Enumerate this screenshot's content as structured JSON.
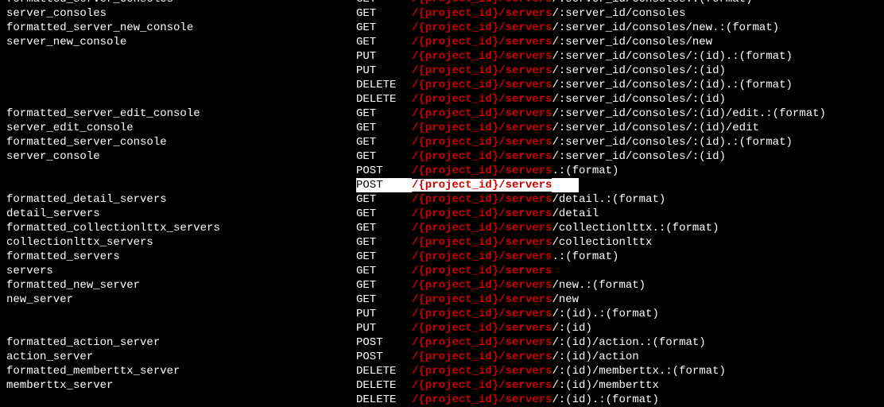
{
  "path_prefix": "/{project_id}/servers",
  "routes": [
    {
      "name": "formatted_server_consoles",
      "method": "GET",
      "tail": "/:server_id/consoles.:(format)",
      "highlight": false,
      "truncated": true
    },
    {
      "name": "server_consoles",
      "method": "GET",
      "tail": "/:server_id/consoles",
      "highlight": false
    },
    {
      "name": "formatted_server_new_console",
      "method": "GET",
      "tail": "/:server_id/consoles/new.:(format)",
      "highlight": false
    },
    {
      "name": "server_new_console",
      "method": "GET",
      "tail": "/:server_id/consoles/new",
      "highlight": false
    },
    {
      "name": "",
      "method": "PUT",
      "tail": "/:server_id/consoles/:(id).:(format)",
      "highlight": false
    },
    {
      "name": "",
      "method": "PUT",
      "tail": "/:server_id/consoles/:(id)",
      "highlight": false
    },
    {
      "name": "",
      "method": "DELETE",
      "tail": "/:server_id/consoles/:(id).:(format)",
      "highlight": false
    },
    {
      "name": "",
      "method": "DELETE",
      "tail": "/:server_id/consoles/:(id)",
      "highlight": false
    },
    {
      "name": "formatted_server_edit_console",
      "method": "GET",
      "tail": "/:server_id/consoles/:(id)/edit.:(format)",
      "highlight": false
    },
    {
      "name": "server_edit_console",
      "method": "GET",
      "tail": "/:server_id/consoles/:(id)/edit",
      "highlight": false
    },
    {
      "name": "formatted_server_console",
      "method": "GET",
      "tail": "/:server_id/consoles/:(id).:(format)",
      "highlight": false
    },
    {
      "name": "server_console",
      "method": "GET",
      "tail": "/:server_id/consoles/:(id)",
      "highlight": false
    },
    {
      "name": "",
      "method": "POST",
      "tail": ".:(format)",
      "highlight": false
    },
    {
      "name": "",
      "method": "POST",
      "tail": "",
      "highlight": true,
      "pad": "    "
    },
    {
      "name": "formatted_detail_servers",
      "method": "GET",
      "tail": "/detail.:(format)",
      "highlight": false
    },
    {
      "name": "detail_servers",
      "method": "GET",
      "tail": "/detail",
      "highlight": false
    },
    {
      "name": "formatted_collectionlttx_servers",
      "method": "GET",
      "tail": "/collectionlttx.:(format)",
      "highlight": false
    },
    {
      "name": "collectionlttx_servers",
      "method": "GET",
      "tail": "/collectionlttx",
      "highlight": false
    },
    {
      "name": "formatted_servers",
      "method": "GET",
      "tail": ".:(format)",
      "highlight": false
    },
    {
      "name": "servers",
      "method": "GET",
      "tail": "",
      "highlight": false
    },
    {
      "name": "formatted_new_server",
      "method": "GET",
      "tail": "/new.:(format)",
      "highlight": false
    },
    {
      "name": "new_server",
      "method": "GET",
      "tail": "/new",
      "highlight": false
    },
    {
      "name": "",
      "method": "PUT",
      "tail": "/:(id).:(format)",
      "highlight": false
    },
    {
      "name": "",
      "method": "PUT",
      "tail": "/:(id)",
      "highlight": false
    },
    {
      "name": "formatted_action_server",
      "method": "POST",
      "tail": "/:(id)/action.:(format)",
      "highlight": false
    },
    {
      "name": "action_server",
      "method": "POST",
      "tail": "/:(id)/action",
      "highlight": false
    },
    {
      "name": "formatted_memberttx_server",
      "method": "DELETE",
      "tail": "/:(id)/memberttx.:(format)",
      "highlight": false
    },
    {
      "name": "memberttx_server",
      "method": "DELETE",
      "tail": "/:(id)/memberttx",
      "highlight": false
    },
    {
      "name": "",
      "method": "DELETE",
      "tail": "/:(id).:(format)",
      "highlight": false
    }
  ]
}
